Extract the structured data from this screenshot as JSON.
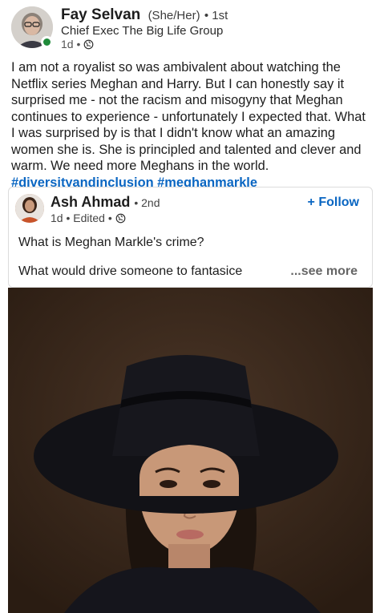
{
  "post": {
    "author_name": "Fay Selvan",
    "pronouns": "(She/Her)",
    "degree": "• 1st",
    "headline": "Chief Exec The Big Life Group",
    "time": "1d •",
    "body": "I am not a royalist so was ambivalent about watching the Netflix series Meghan and Harry. But I can honestly say it surprised me - not the racism and misogyny that Meghan continues to experience - unfortunately I expected that. What I was surprised by is that I didn't know what an amazing women she is. She is principled and talented and clever and warm. We need more Meghans in the world.",
    "hashtags": "#diversityandinclusion #meghanmarkle"
  },
  "shared": {
    "author_name": "Ash Ahmad",
    "degree": "• 2nd",
    "meta": "1d • Edited •",
    "follow_label": "+ Follow",
    "line1": "What is Meghan Markle's crime?",
    "line2": "What would drive someone to fantasice",
    "see_more": "...see more"
  },
  "colors": {
    "link_blue": "#0a66c2",
    "online_green": "#1f8a3a"
  }
}
